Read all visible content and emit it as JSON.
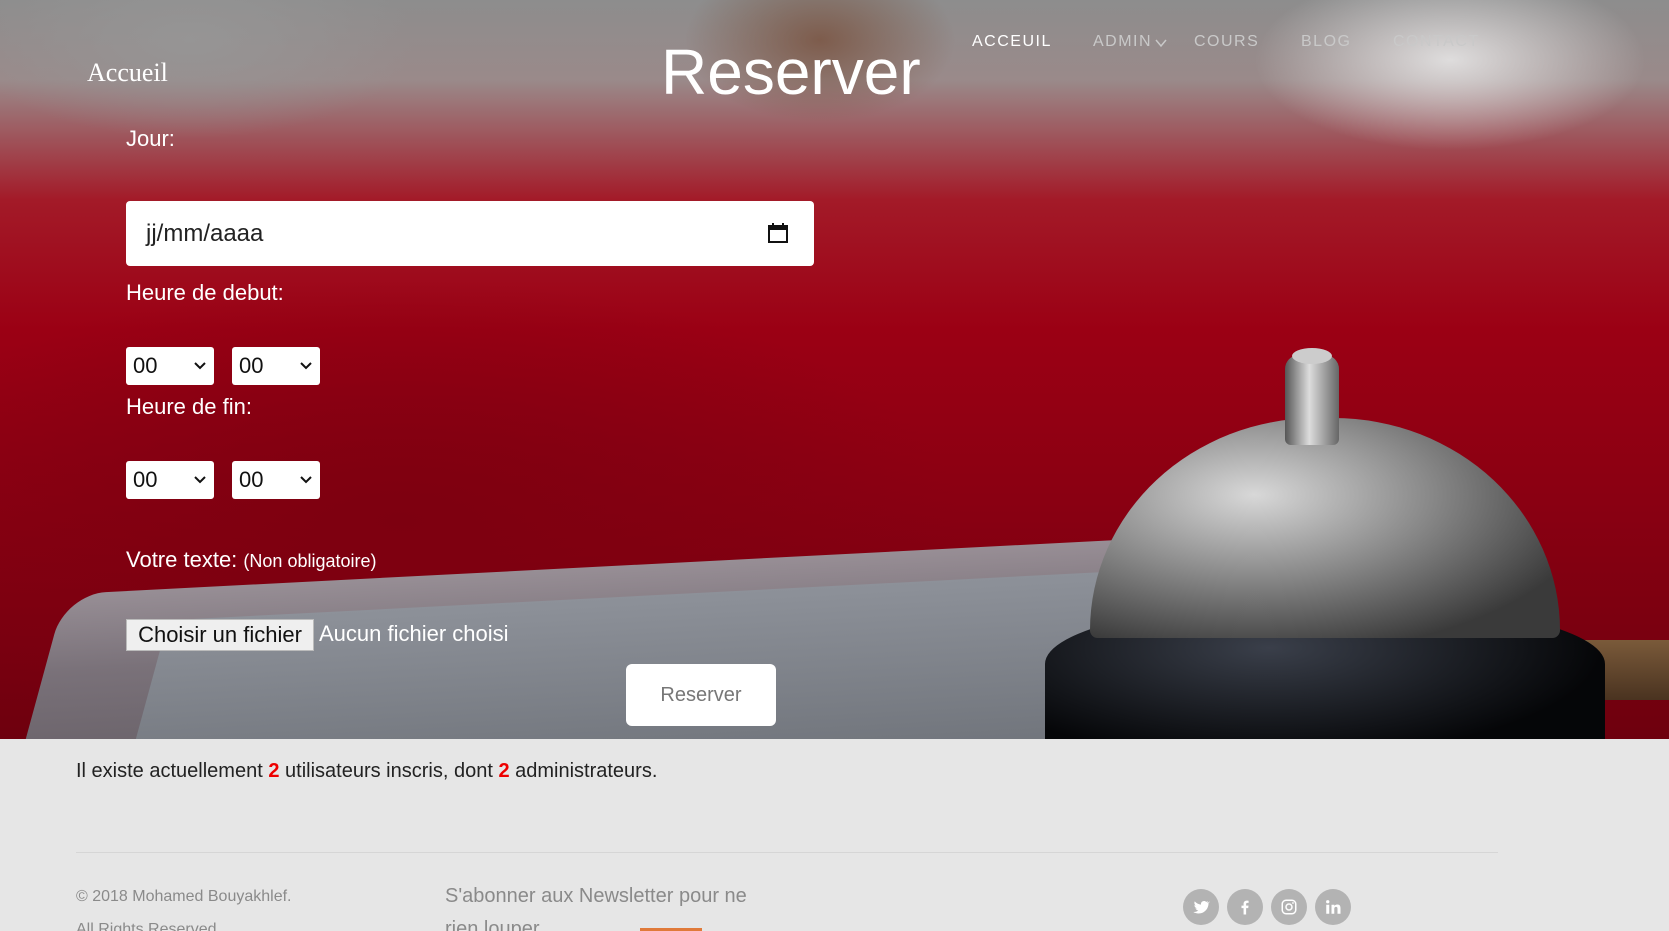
{
  "brand": "Accueil",
  "page_title": "Reserver",
  "nav": {
    "accueil": "ACCEUIL",
    "admin": "ADMIN",
    "cours": "COURS",
    "blog": "BLOG",
    "contact": "CONTACT"
  },
  "form": {
    "jour_label": "Jour:",
    "date_placeholder": "jj/mm/aaaa",
    "heure_debut_label": "Heure de debut:",
    "heure_debut_h": "00",
    "heure_debut_m": "00",
    "heure_fin_label": "Heure de fin:",
    "heure_fin_h": "00",
    "heure_fin_m": "00",
    "texte_label": "Votre texte:",
    "texte_optional": "(Non obligatoire)",
    "file_button": "Choisir un fichier",
    "file_status": "Aucun fichier choisi",
    "submit": "Reserver"
  },
  "stats": {
    "prefix": "Il existe actuellement ",
    "users_count": "2",
    "middle": " utilisateurs inscris, dont ",
    "admins_count": "2",
    "suffix": " administrateurs."
  },
  "footer": {
    "copyright": "© 2018 Mohamed Bouyakhlef.",
    "copyright_line2": "All Rights Reserved.",
    "newsletter_line1": "S'abonner aux Newsletter pour ne",
    "newsletter_line2": "rien louper"
  },
  "socials": [
    "twitter-icon",
    "facebook-icon",
    "instagram-icon",
    "linkedin-icon"
  ],
  "colors": {
    "accent_red": "#e00000",
    "hero_red": "#9b0014",
    "footer_bg": "#e6e6e6"
  }
}
